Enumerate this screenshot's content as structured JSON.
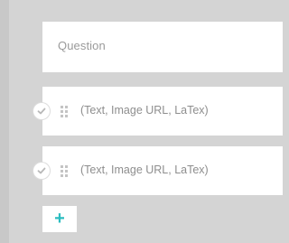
{
  "question": {
    "placeholder": "Question"
  },
  "answers": [
    {
      "placeholder": "(Text, Image URL, LaTex)",
      "check_icon": "check-circle-icon",
      "drag_icon": "drag-handle-icon"
    },
    {
      "placeholder": "(Text, Image URL, LaTex)",
      "check_icon": "check-circle-icon",
      "drag_icon": "drag-handle-icon"
    }
  ],
  "add_button": {
    "label": "+",
    "color": "#2bbdc0"
  },
  "colors": {
    "background": "#d4d4d4",
    "field": "#ffffff",
    "placeholder_text": "#9a9a9a",
    "accent": "#2bbdc0"
  }
}
